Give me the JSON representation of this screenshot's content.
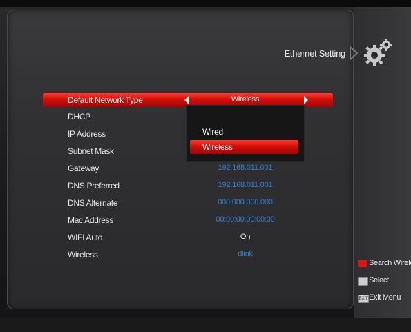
{
  "header": {
    "title": "Ethernet Setting",
    "icons": [
      "arrow-right-icon",
      "gear-icon"
    ]
  },
  "settings": {
    "rows": [
      {
        "label": "Default Network Type",
        "value": "Wireless",
        "selected": true
      },
      {
        "label": "DHCP",
        "value": ""
      },
      {
        "label": "IP Address",
        "value": ""
      },
      {
        "label": "Subnet Mask",
        "value": ""
      },
      {
        "label": "Gateway",
        "value": "192.168.011.001"
      },
      {
        "label": "DNS Preferred",
        "value": "192.168.011.001"
      },
      {
        "label": "DNS Alternate",
        "value": "000.000.000.000"
      },
      {
        "label": "Mac Address",
        "value": "00:00:00:00:00:00"
      },
      {
        "label": "WIFI Auto",
        "value": "On"
      },
      {
        "label": "Wireless",
        "value": "dlink"
      }
    ]
  },
  "dropdown": {
    "options": [
      "Wired",
      "Wireless"
    ],
    "selected": "Wireless"
  },
  "legend": [
    {
      "key": "red",
      "text": "Search Wireless"
    },
    {
      "key": "select-button-icon",
      "text": "Select"
    },
    {
      "key": "exit-button-icon",
      "key_label": "EXIT",
      "text": "Exit Menu"
    }
  ],
  "colors": {
    "accent": "#d40f0a",
    "value_blue": "#2f7fd6",
    "panel": "#333335"
  }
}
